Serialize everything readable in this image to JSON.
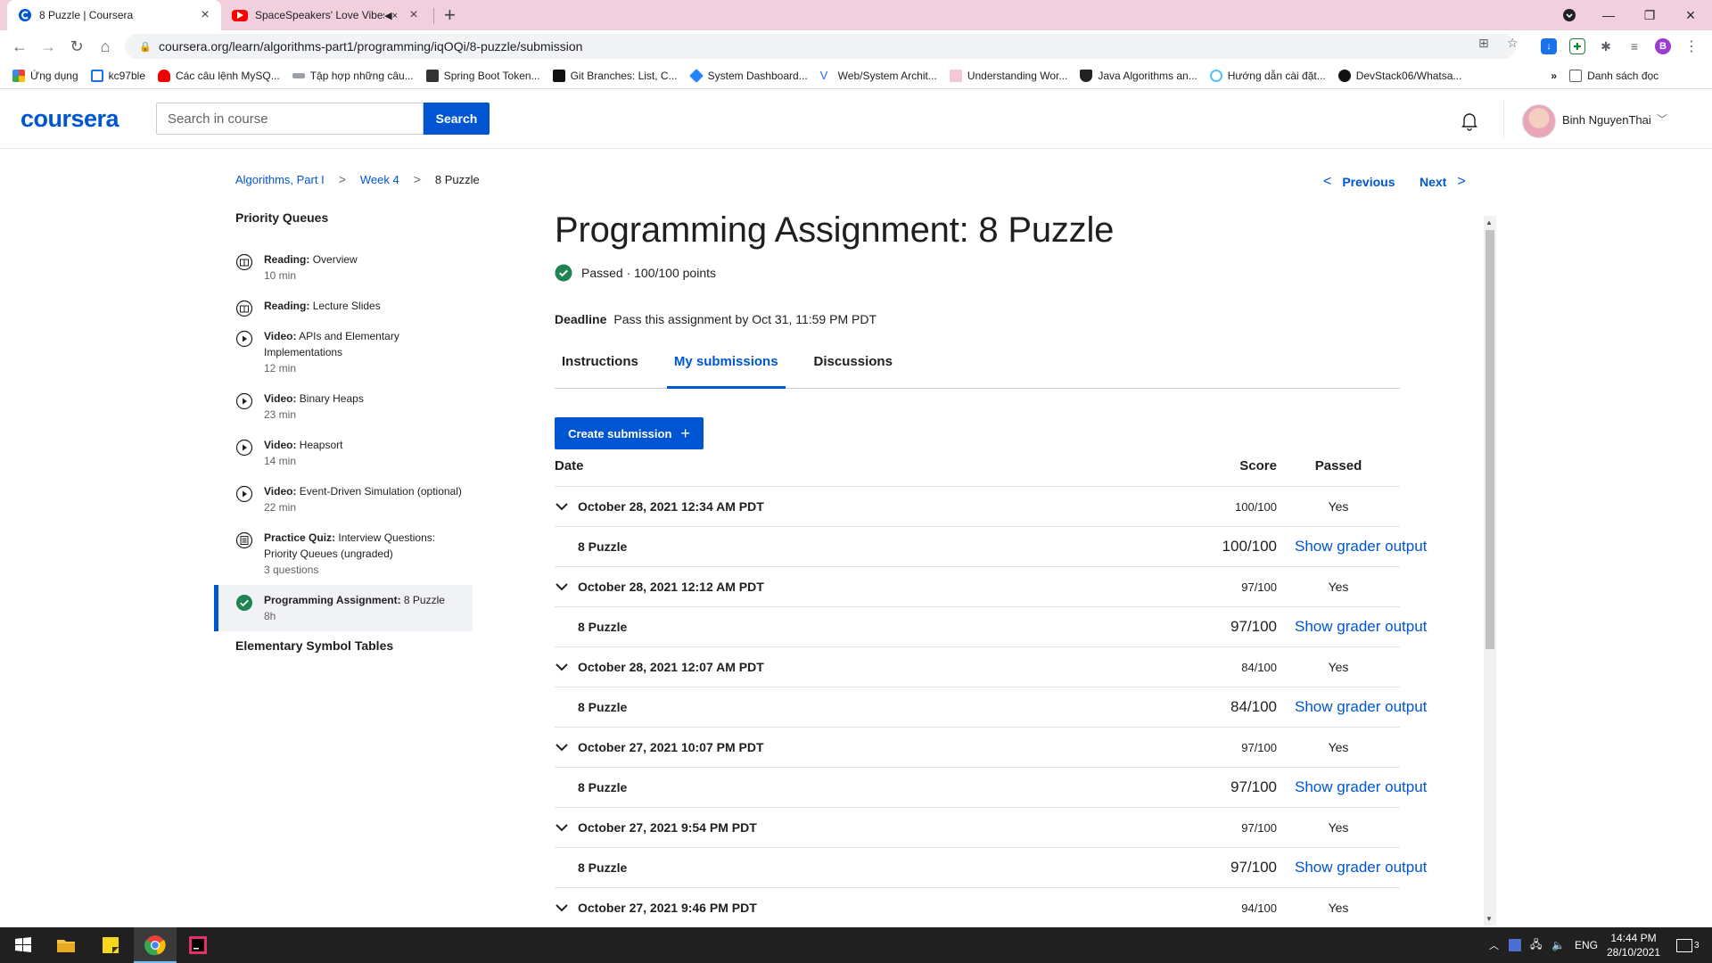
{
  "browser": {
    "tabs": [
      {
        "title": "8 Puzzle | Coursera"
      },
      {
        "title": "SpaceSpeakers' Love Vibes |"
      }
    ],
    "url": "coursera.org/learn/algorithms-part1/programming/iqOQi/8-puzzle/submission",
    "bookmarks": [
      "Ứng dụng",
      "kc97ble",
      "Các câu lệnh MySQ...",
      "Tập hợp những câu...",
      "Spring Boot Token...",
      "Git Branches: List, C...",
      "System Dashboard...",
      "Web/System Archit...",
      "Understanding Wor...",
      "Java Algorithms an...",
      "Hướng dẫn cài đặt...",
      "DevStack06/Whatsa..."
    ],
    "bookmarks_overflow": "»",
    "reading_list": "Danh sách đọc",
    "profile_initial": "B"
  },
  "header": {
    "logo": "coursera",
    "search_placeholder": "Search in course",
    "search_button": "Search",
    "username": "Binh NguyenThai"
  },
  "breadcrumb": [
    "Algorithms, Part I",
    "Week 4",
    "8 Puzzle"
  ],
  "pager": {
    "previous": "Previous",
    "next": "Next"
  },
  "sidebar": {
    "section": "Priority Queues",
    "items": [
      {
        "kind": "Reading:",
        "title": "Overview",
        "meta": "10 min",
        "icon": "reading-icon"
      },
      {
        "kind": "Reading:",
        "title": "Lecture Slides",
        "meta": "",
        "icon": "reading-icon"
      },
      {
        "kind": "Video:",
        "title": "APIs and Elementary Implementations",
        "meta": "12 min",
        "icon": "play-icon"
      },
      {
        "kind": "Video:",
        "title": "Binary Heaps",
        "meta": "23 min",
        "icon": "play-icon"
      },
      {
        "kind": "Video:",
        "title": "Heapsort",
        "meta": "14 min",
        "icon": "play-icon"
      },
      {
        "kind": "Video:",
        "title": "Event-Driven Simulation (optional)",
        "meta": "22 min",
        "icon": "play-icon"
      },
      {
        "kind": "Practice Quiz:",
        "title": "Interview Questions: Priority Queues (ungraded)",
        "meta": "3 questions",
        "icon": "quiz-icon"
      },
      {
        "kind": "Programming Assignment:",
        "title": "8 Puzzle",
        "meta": "8h",
        "icon": "check-circle-icon"
      }
    ],
    "next_section": "Elementary Symbol Tables"
  },
  "main": {
    "title": "Programming Assignment: 8 Puzzle",
    "status": "Passed · 100/100 points",
    "deadline_label": "Deadline",
    "deadline_text": "Pass this assignment by Oct 31, 11:59 PM PDT",
    "tabs": [
      "Instructions",
      "My submissions",
      "Discussions"
    ],
    "create_button": "Create submission",
    "columns": {
      "date": "Date",
      "score": "Score",
      "passed": "Passed"
    },
    "submissions": [
      {
        "date": "October 28, 2021 12:34 AM PDT",
        "score": "100/100",
        "passed": "Yes",
        "part": "8 Puzzle",
        "part_score": "100/100",
        "link": "Show grader output"
      },
      {
        "date": "October 28, 2021 12:12 AM PDT",
        "score": "97/100",
        "passed": "Yes",
        "part": "8 Puzzle",
        "part_score": "97/100",
        "link": "Show grader output"
      },
      {
        "date": "October 28, 2021 12:07 AM PDT",
        "score": "84/100",
        "passed": "Yes",
        "part": "8 Puzzle",
        "part_score": "84/100",
        "link": "Show grader output"
      },
      {
        "date": "October 27, 2021 10:07 PM PDT",
        "score": "97/100",
        "passed": "Yes",
        "part": "8 Puzzle",
        "part_score": "97/100",
        "link": "Show grader output"
      },
      {
        "date": "October 27, 2021 9:54 PM PDT",
        "score": "97/100",
        "passed": "Yes",
        "part": "8 Puzzle",
        "part_score": "97/100",
        "link": "Show grader output"
      },
      {
        "date": "October 27, 2021 9:46 PM PDT",
        "score": "94/100",
        "passed": "Yes"
      }
    ]
  },
  "taskbar": {
    "language": "ENG",
    "time": "14:44 PM",
    "date": "28/10/2021",
    "notifications": "3"
  },
  "colors": {
    "accent": "#0056d2",
    "success": "#1f8354",
    "tabstrip": "#f2cfdc"
  }
}
